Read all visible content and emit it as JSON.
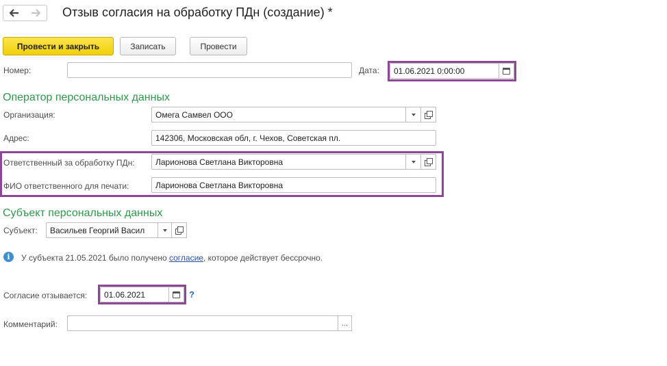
{
  "header": {
    "title": "Отзыв согласия на обработку ПДн (создание) *",
    "back_icon": "arrow-left-icon",
    "forward_icon": "arrow-right-icon"
  },
  "toolbar": {
    "post_and_close": "Провести и закрыть",
    "save": "Записать",
    "post": "Провести"
  },
  "form": {
    "number_label": "Номер:",
    "number_value": "",
    "date_label": "Дата:",
    "date_value": "01.06.2021  0:00:00",
    "operator_section": "Оператор персональных данных",
    "organization_label": "Организация:",
    "organization_value": "Омега Самвел ООО",
    "address_label": "Адрес:",
    "address_value": "142306, Московская обл, г. Чехов, Советская пл.",
    "responsible_label": "Ответственный за обработку ПДн:",
    "responsible_value": "Ларионова Светлана Викторовна",
    "print_name_label": "ФИО ответственного для печати:",
    "print_name_value": "Ларионова Светлана Викторовна",
    "subject_section": "Субъект персональных данных",
    "subject_label": "Субъект:",
    "subject_value": "Васильев Георгий Васил",
    "info_prefix": "У субъекта 21.05.2021 было получено ",
    "info_link": "согласие",
    "info_suffix": ", которое действует бессрочно.",
    "revoked_label": "Согласие отзывается:",
    "revoked_value": "01.06.2021",
    "help": "?",
    "comment_label": "Комментарий:",
    "comment_value": "",
    "ellipsis": "..."
  },
  "colors": {
    "primary_button": "#f2cf0b",
    "section_title": "#2d9a4a",
    "highlight_frame": "#8d4796",
    "info_icon": "#3d8fd1"
  }
}
